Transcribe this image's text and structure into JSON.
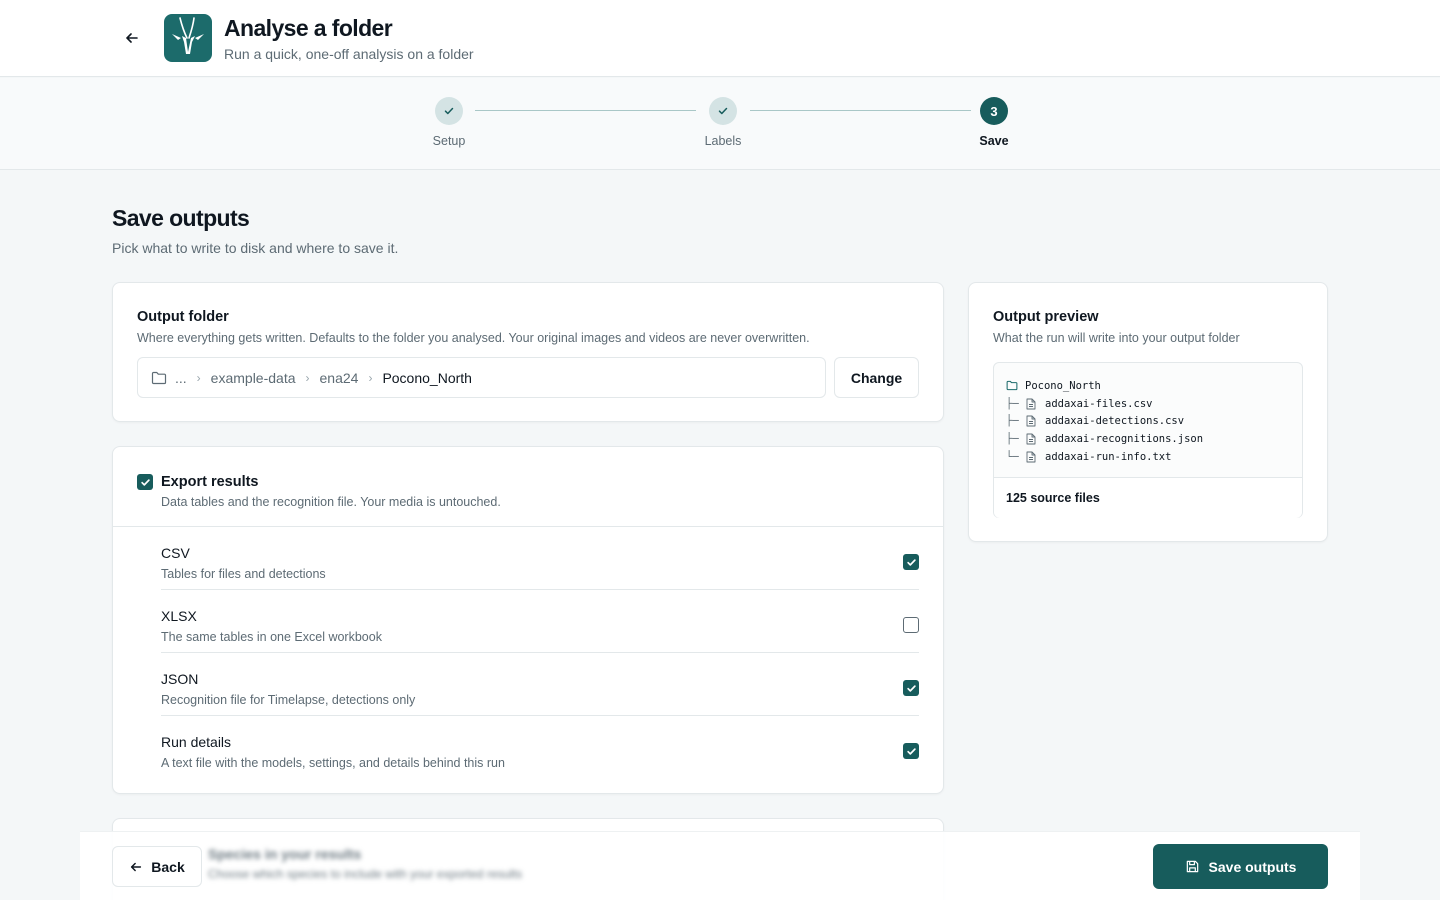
{
  "header": {
    "title": "Analyse a folder",
    "subtitle": "Run a quick, one-off analysis on a folder"
  },
  "stepper": {
    "steps": [
      {
        "label": "Setup",
        "state": "done"
      },
      {
        "label": "Labels",
        "state": "done"
      },
      {
        "label": "Save",
        "state": "active",
        "number": "3"
      }
    ]
  },
  "page": {
    "title": "Save outputs",
    "subtitle": "Pick what to write to disk and where to save it."
  },
  "output_folder": {
    "title": "Output folder",
    "description": "Where everything gets written. Defaults to the folder you analysed. Your original images and videos are never overwritten.",
    "path": [
      "...",
      "example-data",
      "ena24",
      "Pocono_North"
    ],
    "change_label": "Change"
  },
  "export": {
    "title": "Export results",
    "description": "Data tables and the recognition file. Your media is untouched.",
    "checked": true,
    "options": [
      {
        "name": "CSV",
        "description": "Tables for files and detections",
        "checked": true
      },
      {
        "name": "XLSX",
        "description": "The same tables in one Excel workbook",
        "checked": false
      },
      {
        "name": "JSON",
        "description": "Recognition file for Timelapse, detections only",
        "checked": true
      },
      {
        "name": "Run details",
        "description": "A text file with the models, settings, and details behind this run",
        "checked": true
      }
    ]
  },
  "preview": {
    "title": "Output preview",
    "description": "What the run will write into your output folder",
    "folder": "Pocono_North",
    "files": [
      {
        "branch": "├─",
        "name": "addaxai-files.csv"
      },
      {
        "branch": "├─",
        "name": "addaxai-detections.csv"
      },
      {
        "branch": "├─",
        "name": "addaxai-recognitions.json"
      },
      {
        "branch": "└─",
        "name": "addaxai-run-info.txt"
      }
    ],
    "footer": "125 source files"
  },
  "next_section": {
    "title": "Species in your results",
    "description": "Choose which species to include with your exported results"
  },
  "footer": {
    "back_label": "Back",
    "save_label": "Save outputs"
  },
  "colors": {
    "accent": "#175c5c",
    "accent_light": "#d4e3e4",
    "muted_text": "#5d6b74"
  }
}
